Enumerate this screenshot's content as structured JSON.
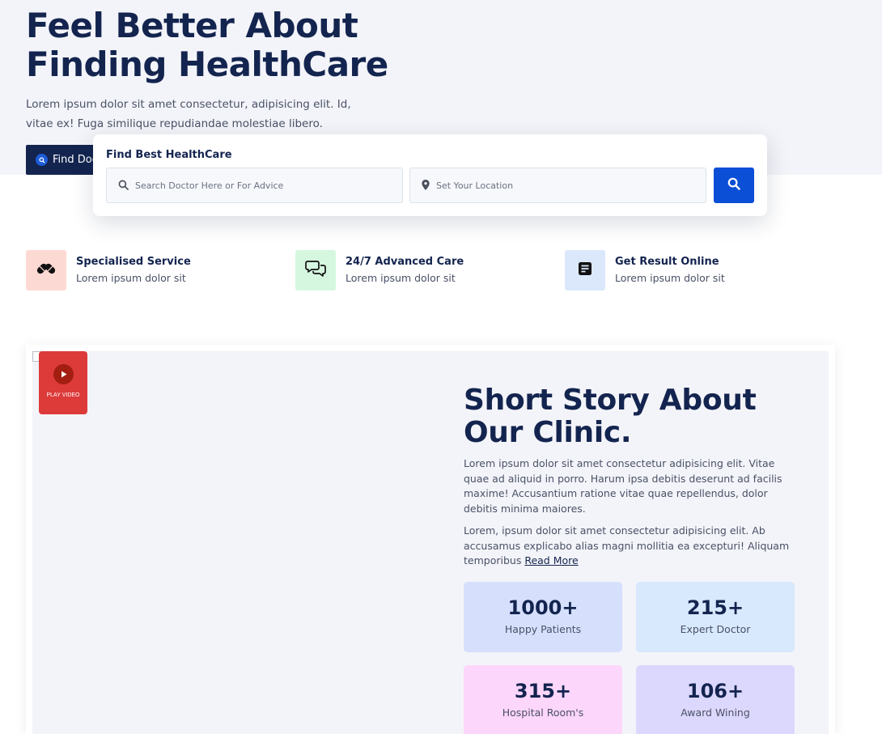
{
  "hero": {
    "title": "Feel Better About Finding HealthCare",
    "description": "Lorem ipsum dolor sit amet consectetur, adipisicing elit. Id, vitae ex! Fuga similique repudiandae molestiae libero.",
    "find_button_label": "Find Doctor"
  },
  "search": {
    "title": "Find Best HealthCare",
    "doctor_placeholder": "Search Doctor Here or For Advice",
    "location_placeholder": "Set Your Location",
    "icons": {
      "doctor": "search-icon",
      "location": "map-pin-icon",
      "submit": "search-icon"
    },
    "accent": "#0b4fd6"
  },
  "features": [
    {
      "title": "Specialised Service",
      "subtitle": "Lorem ipsum dolor sit",
      "icon": "pills-icon",
      "color": "#fdd9d4"
    },
    {
      "title": "24/7 Advanced Care",
      "subtitle": "Lorem ipsum dolor sit",
      "icon": "chat-bubbles-icon",
      "color": "#d6f7df"
    },
    {
      "title": "Get Result Online",
      "subtitle": "Lorem ipsum dolor sit",
      "icon": "document-icon",
      "color": "#dbe8fc"
    }
  ],
  "story": {
    "play_label": "PLAY VIDEO",
    "title": "Short Story About Our Clinic.",
    "paragraph1": "Lorem ipsum dolor sit amet consectetur adipisicing elit. Vitae quae ad aliquid in porro. Harum ipsa debitis deserunt ad facilis maxime! Accusantium ratione vitae quae repellendus, dolor debitis minima maiores.",
    "paragraph2": "Lorem, ipsum dolor sit amet consectetur adipisicing elit. Ab accusamus explicabo alias magni mollitia ea excepturi! Aliquam temporibus",
    "read_more": "Read More"
  },
  "stats": [
    {
      "value": "1000+",
      "label": "Happy Patients",
      "color": "#d6e0fd"
    },
    {
      "value": "215+",
      "label": "Expert Doctor",
      "color": "#d8e8fd"
    },
    {
      "value": "315+",
      "label": "Hospital Room's",
      "color": "#fdd6fb"
    },
    {
      "value": "106+",
      "label": "Award Wining",
      "color": "#dcd7fd"
    }
  ],
  "colors": {
    "navy": "#13244f",
    "hero_bg": "#f3f4f9",
    "play_red": "#dd3a3a"
  }
}
